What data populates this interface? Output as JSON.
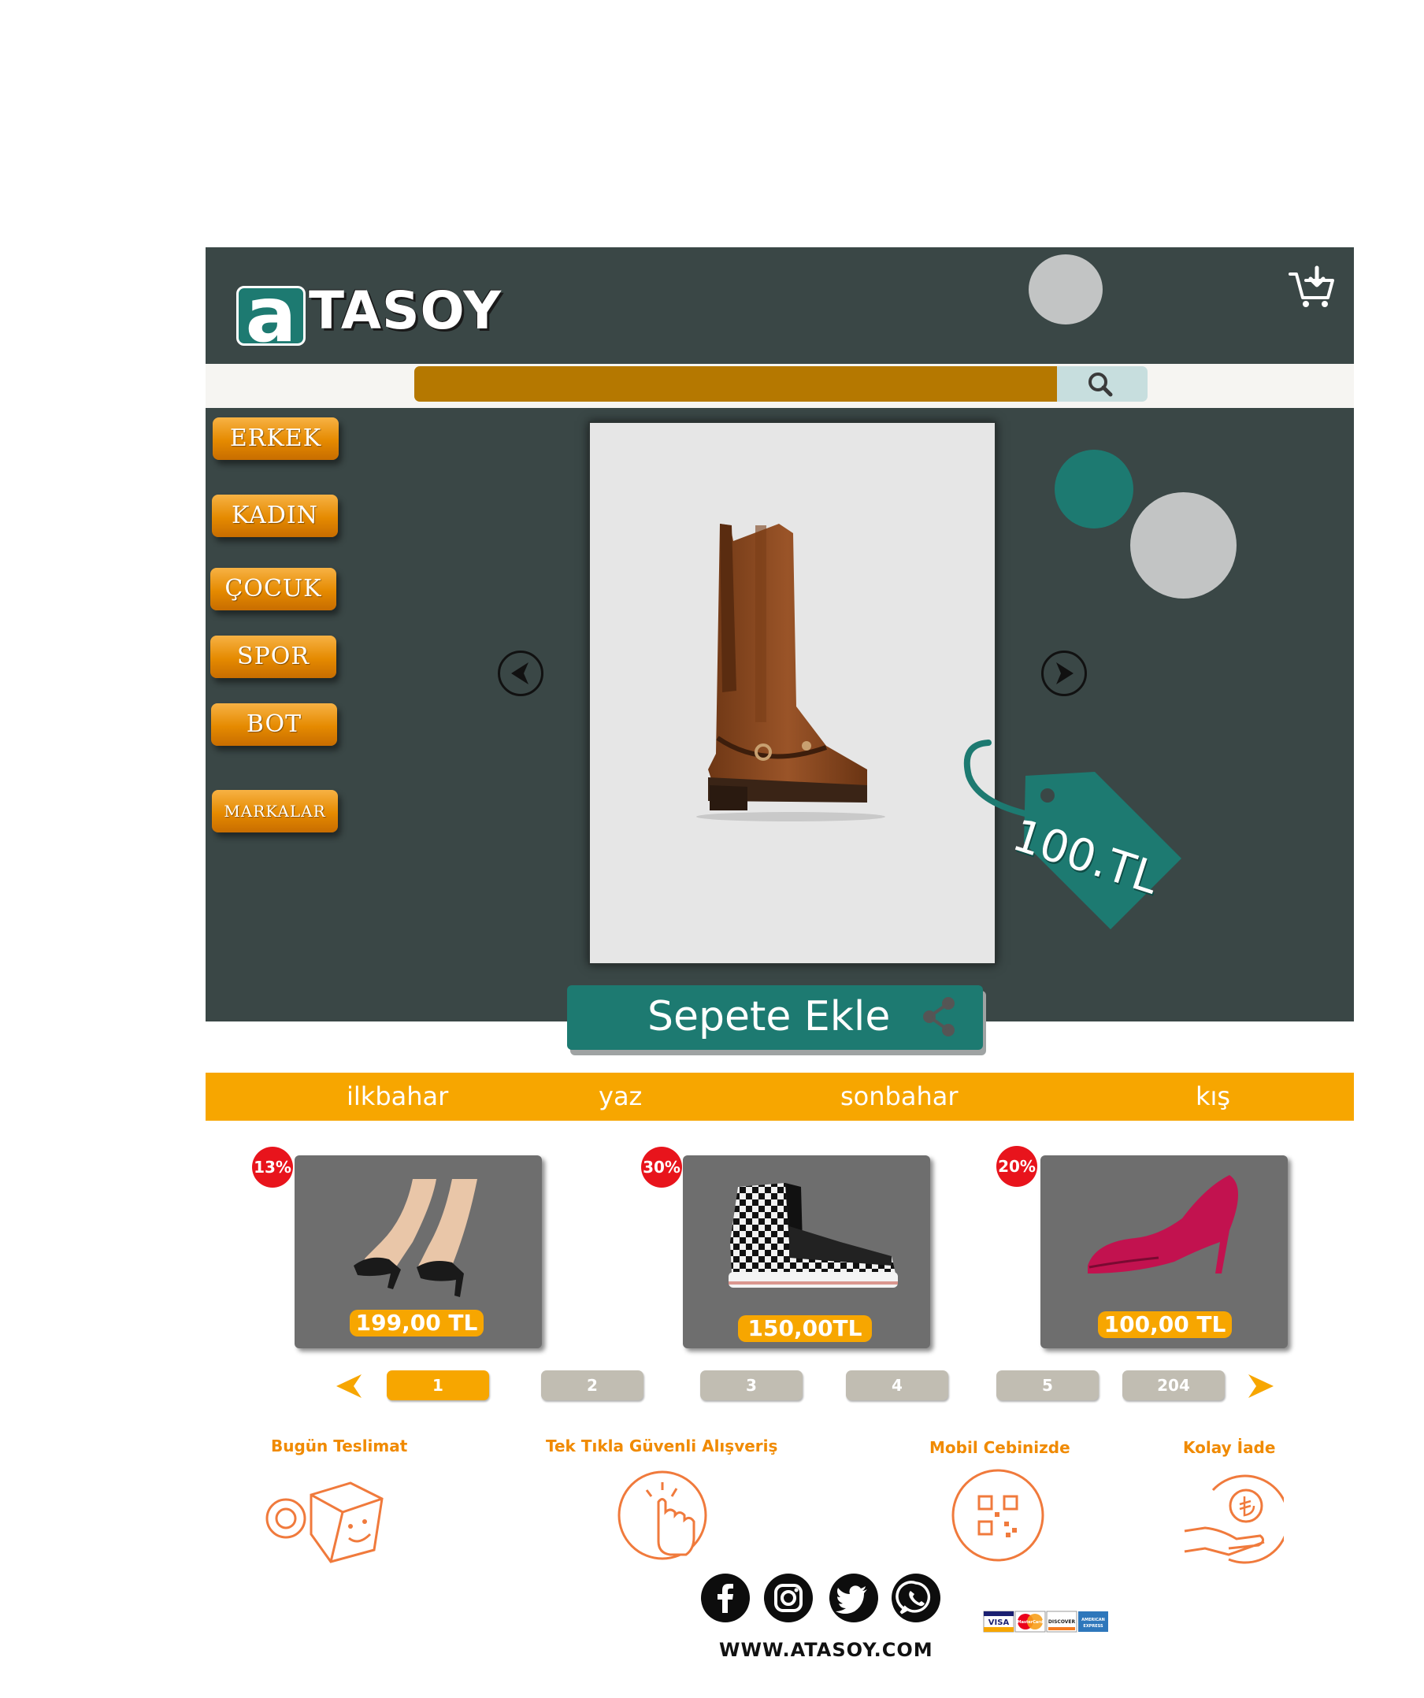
{
  "header": {
    "logo_letter": "a",
    "logo_text": "TASOY",
    "cart_icon": "cart-download-icon"
  },
  "search": {
    "placeholder": "",
    "icon": "search-icon"
  },
  "categories": [
    "ERKEK",
    "KADIN",
    "ÇOCUK",
    "SPOR",
    "BOT",
    "MARKALAR"
  ],
  "hero": {
    "product_icon": "brown-boot-image",
    "price_tag": "100.TL",
    "prev_icon": "arrow-left-circle-icon",
    "next_icon": "arrow-right-circle-icon",
    "add_to_cart_label": "Sepete Ekle",
    "share_icon": "share-icon"
  },
  "seasons": [
    "ilkbahar",
    "yaz",
    "sonbahar",
    "kış"
  ],
  "products": [
    {
      "badge": "13%",
      "price": "199,00 TL",
      "image": "black-heels-image"
    },
    {
      "badge": "30%",
      "price": "150,00TL",
      "image": "checkered-sneaker-image"
    },
    {
      "badge": "20%",
      "price": "100,00 TL",
      "image": "pink-pump-image"
    }
  ],
  "pagination": {
    "pages": [
      "1",
      "2",
      "3",
      "4",
      "5",
      "204"
    ],
    "active": "1",
    "prev_icon": "chevron-left-icon",
    "next_icon": "chevron-right-icon"
  },
  "features": [
    {
      "title": "Bugün Teslimat",
      "icon": "delivery-box-icon"
    },
    {
      "title": "Tek Tıkla Güvenli Alışveriş",
      "icon": "tap-hand-icon"
    },
    {
      "title": "Mobil Cebinizde",
      "icon": "qr-code-icon"
    },
    {
      "title": "Kolay İade",
      "icon": "money-return-icon"
    }
  ],
  "footer": {
    "social": [
      "facebook-icon",
      "instagram-icon",
      "twitter-icon",
      "whatsapp-icon"
    ],
    "url": "WWW.ATASOY.COM",
    "payments": [
      "VISA",
      "MasterCard",
      "DISCOVER",
      "AMERICAN EXPRESS"
    ]
  },
  "colors": {
    "header_bg": "#3a4746",
    "accent_orange": "#f7a600",
    "teal": "#1d7a71",
    "search_field": "#b57800",
    "badge_red": "#e8141c"
  }
}
